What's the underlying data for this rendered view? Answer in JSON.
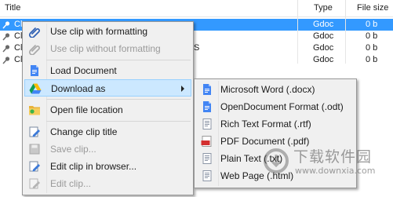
{
  "columns": {
    "title": "Title",
    "type": "Type",
    "size": "File size"
  },
  "rows": [
    {
      "title": "Cl",
      "type": "Gdoc",
      "size": "0 b",
      "tail": ""
    },
    {
      "title": "Cl",
      "type": "Gdoc",
      "size": "0 b",
      "tail": ""
    },
    {
      "title": "Cl",
      "type": "Gdoc",
      "size": "0 b",
      "tail": "S"
    },
    {
      "title": "Cl",
      "type": "Gdoc",
      "size": "0 b",
      "tail": ""
    }
  ],
  "context_menu": {
    "items": [
      {
        "label": "Use clip with formatting",
        "icon": "paperclip-icon",
        "disabled": false
      },
      {
        "label": "Use clip without formatting",
        "icon": "paperclip-icon",
        "disabled": true
      },
      {
        "label": "Load Document",
        "icon": "google-doc-icon",
        "disabled": false
      },
      {
        "label": "Download as",
        "icon": "google-drive-icon",
        "disabled": false
      },
      {
        "label": "Open file location",
        "icon": "folder-icon",
        "disabled": false
      },
      {
        "label": "Change clip title",
        "icon": "pencil-page-icon",
        "disabled": false
      },
      {
        "label": "Save clip...",
        "icon": "save-icon",
        "disabled": true
      },
      {
        "label": "Edit clip in browser...",
        "icon": "pencil-page-icon",
        "disabled": false
      },
      {
        "label": "Edit clip...",
        "icon": "pencil-page-icon",
        "disabled": true
      }
    ]
  },
  "download_submenu": {
    "items": [
      {
        "label": "Microsoft Word (.docx)",
        "icon": "word-doc-icon"
      },
      {
        "label": "OpenDocument Format (.odt)",
        "icon": "odt-doc-icon"
      },
      {
        "label": "Rich Text Format (.rtf)",
        "icon": "rtf-doc-icon"
      },
      {
        "label": "PDF Document (.pdf)",
        "icon": "pdf-icon"
      },
      {
        "label": "Plain Text (.txt)",
        "icon": "txt-doc-icon"
      },
      {
        "label": "Web Page (.html)",
        "icon": "html-doc-icon"
      }
    ]
  },
  "watermark": {
    "line1": "下载软件园",
    "line2": "www.downxia.com"
  },
  "colors": {
    "selection": "#3399ff",
    "hover": "#cce8ff",
    "accent_blue": "#4285f4",
    "pdf_red": "#d32f2f"
  }
}
